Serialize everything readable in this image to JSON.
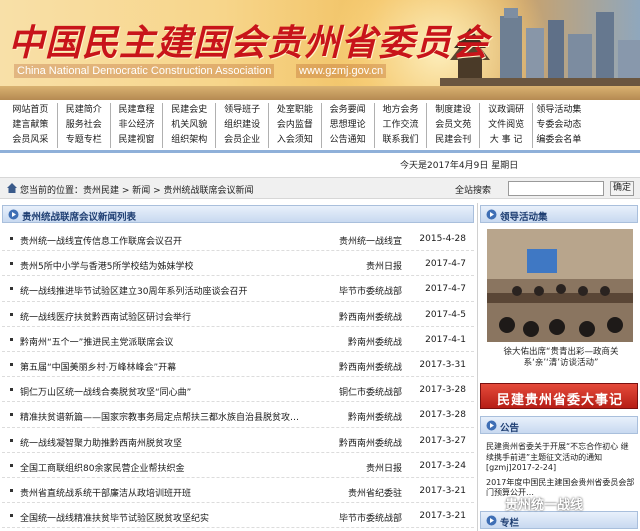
{
  "banner": {
    "title": "中国民主建国会贵州省委员会",
    "en_name": "China National Democratic Construction Association",
    "url": "www.gzmj.gov.cn"
  },
  "nav": {
    "rows": [
      [
        "网站首页",
        "民建简介",
        "民建章程",
        "民建会史",
        "领导班子",
        "处室职能",
        "会务要闻",
        "地方会务",
        "制度建设",
        "议政调研",
        "领导活动集"
      ],
      [
        "建言献策",
        "服务社会",
        "非公经济",
        "机关风貌",
        "组织建设",
        "会内监督",
        "思想理论",
        "工作交流",
        "会员文苑",
        "文件阅览",
        "专委会动态"
      ],
      [
        "会员风采",
        "专题专栏",
        "民建视窗",
        "组织架构",
        "会员企业",
        "入会须知",
        "公告通知",
        "联系我们",
        "民建会刊",
        "大 事 记",
        "编委会名单"
      ]
    ]
  },
  "date_text": "今天是2017年4月9日  星期日",
  "location": {
    "text": "您当前的位置：贵州民建 > 新闻 > 贵州统战联席会议新闻",
    "search_label": "全站搜索",
    "search_button": "确定"
  },
  "main": {
    "title": "贵州统战联席会议新闻列表",
    "news": [
      {
        "title": "贵州统一战线宣传信息工作联席会议召开",
        "source": "贵州统一战线宣",
        "date": "2015-4-28"
      },
      {
        "title": "贵州5所中小学与香港5所学校结为姊妹学校",
        "source": "贵州日报",
        "date": "2017-4-7"
      },
      {
        "title": "统一战线推进毕节试验区建立30周年系列活动座谈会召开",
        "source": "毕节市委统战部",
        "date": "2017-4-7"
      },
      {
        "title": "统一战线医疗扶贫黔西南试验区研讨会举行",
        "source": "黔西南州委统战",
        "date": "2017-4-5"
      },
      {
        "title": "黔南州“五个一”推进民主党派联席会议",
        "source": "黔南州委统战",
        "date": "2017-4-1"
      },
      {
        "title": "第五届“中国美丽乡村·万峰林峰会”开幕",
        "source": "黔西南州委统战",
        "date": "2017-3-31"
      },
      {
        "title": "铜仁万山区统一战线合奏脱贫攻坚“同心曲”",
        "source": "铜仁市委统战部",
        "date": "2017-3-28"
      },
      {
        "title": "精准扶贫谱新篇——国家宗教事务局定点帮扶三都水族自治县脱贫攻…",
        "source": "黔南州委统战",
        "date": "2017-3-28"
      },
      {
        "title": "统一战线凝智聚力助推黔西南州脱贫攻坚",
        "source": "黔西南州委统战",
        "date": "2017-3-27"
      },
      {
        "title": "全国工商联组织80余家民营企业帮扶织金",
        "source": "贵州日报",
        "date": "2017-3-24"
      },
      {
        "title": "贵州省直统战系统干部廉洁从政培训班开班",
        "source": "贵州省纪委驻",
        "date": "2017-3-21"
      },
      {
        "title": "全国统一战线精准扶贫毕节试验区脱贫攻坚纪实",
        "source": "毕节市委统战部",
        "date": "2017-3-21"
      }
    ]
  },
  "sidebar": {
    "leader_title": "领导活动集",
    "leader_caption": "徐大佑出席“贵青出彩—政商关系‘亲’‘清’访谈活动”",
    "promo_text": "民建贵州省委大事记",
    "notice_title": "公告",
    "notices": [
      "民建贵州省委关于开展“不忘合作初心 继续携手前进”主题征文活动的通知 [gzmj]2017-2-24]",
      "2017年度中国民主建国会贵州省委员会部门预算公开…"
    ],
    "column_title": "专栏",
    "watermark": "贵州统一战线"
  },
  "colors": {
    "title_red": "#c8141a",
    "panel_blue": "#1f3f73",
    "promo_red": "#b61e16"
  }
}
